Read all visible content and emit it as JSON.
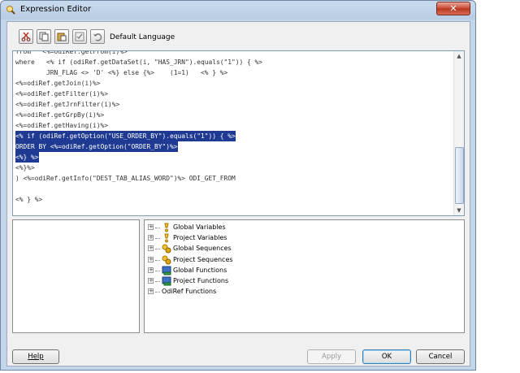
{
  "window": {
    "title": "Expression Editor",
    "close_glyph": "✕"
  },
  "toolbar": {
    "icons": [
      "cut-icon",
      "copy-icon",
      "paste-icon",
      "check-syntax-icon",
      "undo-icon"
    ],
    "language_label": "Default Language"
  },
  "editor": {
    "lines": [
      {
        "text": "from   <%=odiRef.getFrom(i)%>",
        "selected": false
      },
      {
        "text": "where   <% if (odiRef.getDataSet(i, \"HAS_JRN\").equals(\"1\")) { %>",
        "selected": false
      },
      {
        "text": "        JRN_FLAG <> 'D' <%} else {%>    (1=1)   <% } %>",
        "selected": false
      },
      {
        "text": "<%=odiRef.getJoin(i)%>",
        "selected": false
      },
      {
        "text": "<%=odiRef.getFilter(i)%>",
        "selected": false
      },
      {
        "text": "<%=odiRef.getJrnFilter(i)%>",
        "selected": false
      },
      {
        "text": "<%=odiRef.getGrpBy(i)%>",
        "selected": false
      },
      {
        "text": "<%=odiRef.getHaving(i)%>",
        "selected": false
      },
      {
        "text": "<% if (odiRef.getOption(\"USE_ORDER_BY\").equals(\"1\")) { %>",
        "selected": true
      },
      {
        "text": "ORDER BY <%=odiRef.getOption(\"ORDER_BY\")%>",
        "selected": true
      },
      {
        "text": "<%} %>",
        "selected": true
      },
      {
        "text": "<%}%>",
        "selected": false
      },
      {
        "text": ") <%=odiRef.getInfo(\"DEST_TAB_ALIAS_WORD\")%> ODI_GET_FROM",
        "selected": false
      },
      {
        "text": "",
        "selected": false
      },
      {
        "text": "<% } %>",
        "selected": false
      }
    ],
    "selection_color": "#1f3a93",
    "quote_color": "#a0199e"
  },
  "tree": {
    "items": [
      {
        "label": "Global Variables",
        "icon": "variable-icon"
      },
      {
        "label": "Project Variables",
        "icon": "variable-icon"
      },
      {
        "label": "Global Sequences",
        "icon": "sequence-icon"
      },
      {
        "label": "Project Sequences",
        "icon": "sequence-icon"
      },
      {
        "label": "Global Functions",
        "icon": "function-icon"
      },
      {
        "label": "Project Functions",
        "icon": "function-icon"
      },
      {
        "label": "OdiRef Functions",
        "icon": ""
      }
    ]
  },
  "buttons": {
    "help": "Help",
    "apply": "Apply",
    "ok": "OK",
    "cancel": "Cancel"
  }
}
